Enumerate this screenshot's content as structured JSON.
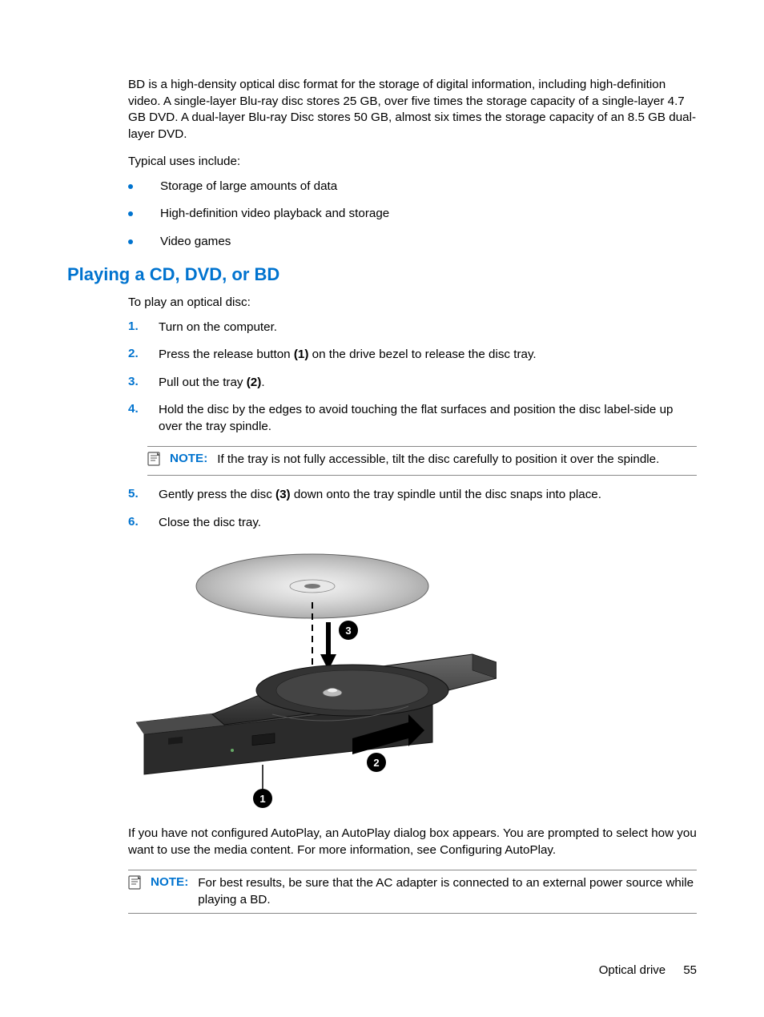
{
  "intro_para": "BD is a high-density optical disc format for the storage of digital information, including high-definition video. A single-layer Blu-ray disc stores 25 GB, over five times the storage capacity of a single-layer 4.7 GB DVD. A dual-layer Blu-ray Disc stores 50 GB, almost six times the storage capacity of an 8.5 GB dual-layer DVD.",
  "uses_intro": "Typical uses include:",
  "bullets": [
    "Storage of large amounts of data",
    "High-definition video playback and storage",
    "Video games"
  ],
  "heading": "Playing a CD, DVD, or BD",
  "play_intro": "To play an optical disc:",
  "steps": {
    "s1": "Turn on the computer.",
    "s2_a": "Press the release button ",
    "s2_b": "(1)",
    "s2_c": " on the drive bezel to release the disc tray.",
    "s3_a": "Pull out the tray ",
    "s3_b": "(2)",
    "s3_c": ".",
    "s4": "Hold the disc by the edges to avoid touching the flat surfaces and position the disc label-side up over the tray spindle.",
    "s5_a": "Gently press the disc ",
    "s5_b": "(3)",
    "s5_c": " down onto the tray spindle until the disc snaps into place.",
    "s6": "Close the disc tray."
  },
  "note1_label": "NOTE:",
  "note1_text": "If the tray is not fully accessible, tilt the disc carefully to position it over the spindle.",
  "post_para": "If you have not configured AutoPlay, an AutoPlay dialog box appears. You are prompted to select how you want to use the media content. For more information, see Configuring AutoPlay.",
  "note2_label": "NOTE:",
  "note2_text": "For best results, be sure that the AC adapter is connected to an external power source while playing a BD.",
  "footer_section": "Optical drive",
  "footer_page": "55",
  "callouts": {
    "c1": "1",
    "c2": "2",
    "c3": "3"
  }
}
